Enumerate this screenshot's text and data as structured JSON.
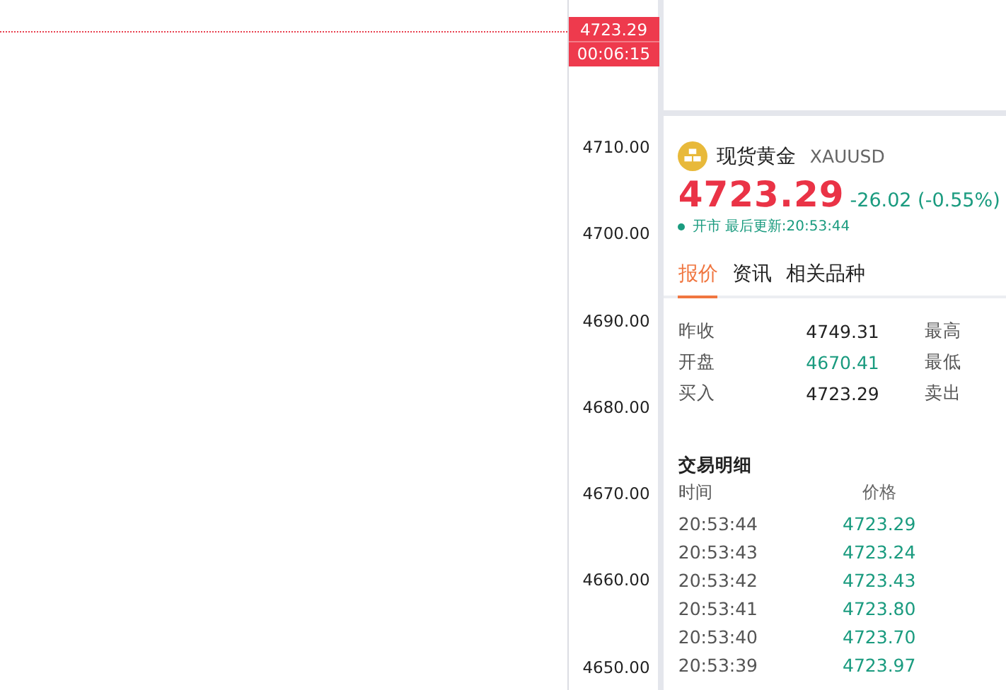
{
  "chart": {
    "last_price_tag": {
      "price": "4723.29",
      "countdown": "00:06:15"
    },
    "price_axis": [
      "4710.00",
      "4700.00",
      "4690.00",
      "4680.00",
      "4670.00",
      "4660.00",
      "4650.00"
    ]
  },
  "quote": {
    "name": "现货黄金",
    "symbol": "XAUUSD",
    "price": "4723.29",
    "change": "-26.02 (-0.55%)",
    "status": "开市",
    "last_update": "最后更新:20:53:44",
    "tabs": [
      {
        "label": "报价",
        "selected": true
      },
      {
        "label": "资讯",
        "selected": false
      },
      {
        "label": "相关品种",
        "selected": false
      }
    ],
    "stats": [
      {
        "label": "昨收",
        "value": "4749.31",
        "color": "#222222",
        "label_2": "最高"
      },
      {
        "label": "开盘",
        "value": "4670.41",
        "color": "#1a9b7f",
        "label_2": "最低"
      },
      {
        "label": "买入",
        "value": "4723.29",
        "color": "#222222",
        "label_2": "卖出"
      }
    ]
  },
  "trades": {
    "title": "交易明细",
    "columns": [
      "时间",
      "价格"
    ],
    "rows": [
      {
        "time": "20:53:44",
        "price": "4723.29",
        "color": "#1a9b7f"
      },
      {
        "time": "20:53:43",
        "price": "4723.24",
        "color": "#1a9b7f"
      },
      {
        "time": "20:53:42",
        "price": "4723.43",
        "color": "#1a9b7f"
      },
      {
        "time": "20:53:41",
        "price": "4723.80",
        "color": "#1a9b7f"
      },
      {
        "time": "20:53:40",
        "price": "4723.70",
        "color": "#1a9b7f"
      },
      {
        "time": "20:53:39",
        "price": "4723.97",
        "color": "#1a9b7f"
      }
    ]
  }
}
